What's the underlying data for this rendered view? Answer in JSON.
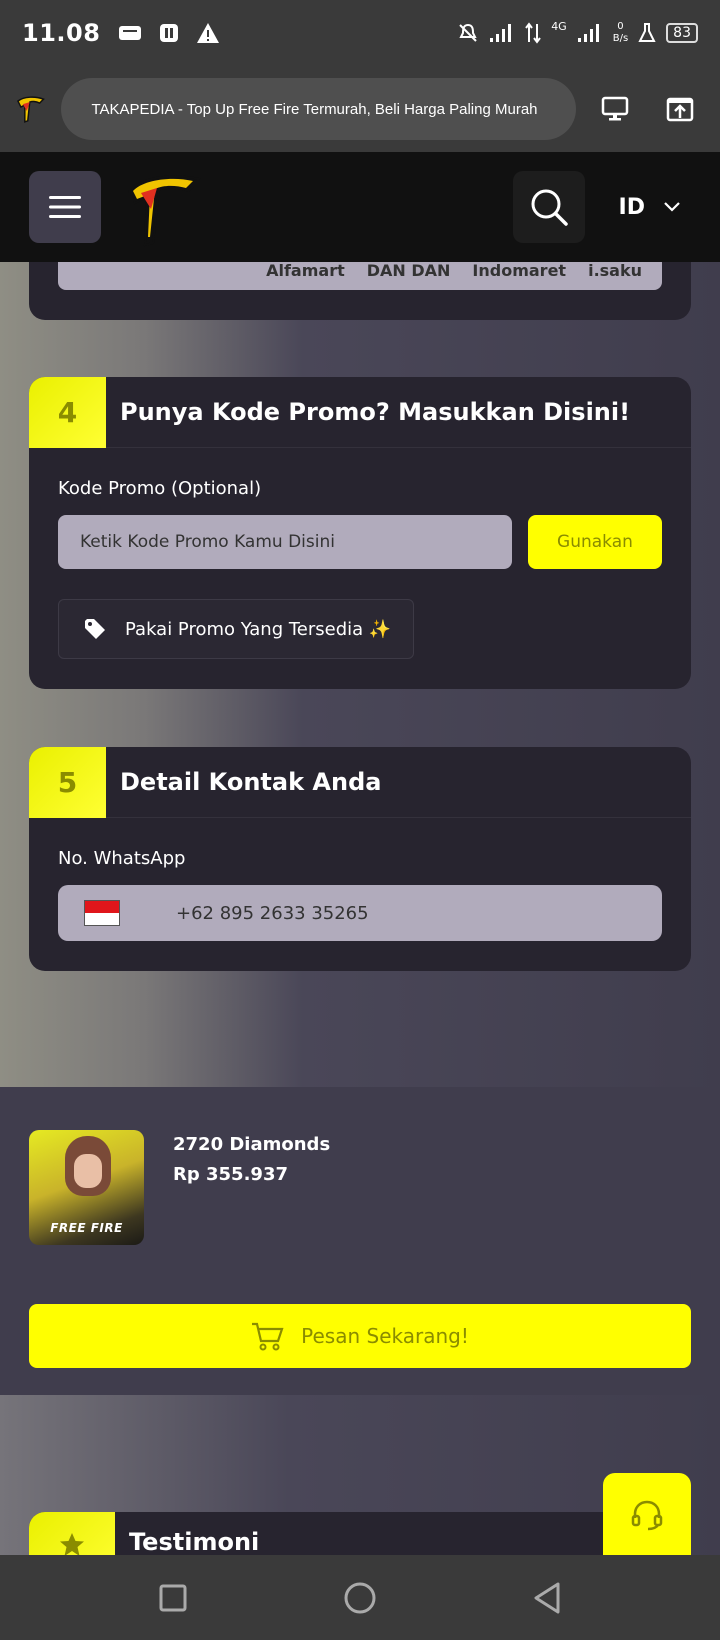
{
  "status_bar": {
    "time": "11.08",
    "network": "4G",
    "speed_value": "0",
    "speed_unit": "B/s",
    "battery": "83"
  },
  "browser": {
    "url_title": "TAKAPEDIA - Top Up Free Fire Termurah, Beli Harga Paling Murah"
  },
  "header": {
    "language": "ID"
  },
  "payment_strip": {
    "logos": [
      "Alfamart",
      "DAN DAN",
      "Indomaret",
      "i.saku"
    ]
  },
  "promo_card": {
    "step": "4",
    "title": "Punya Kode Promo? Masukkan Disini!",
    "field_label": "Kode Promo (Optional)",
    "input_placeholder": "Ketik Kode Promo Kamu Disini",
    "apply_button": "Gunakan",
    "available_button": "Pakai Promo Yang Tersedia ✨"
  },
  "contact_card": {
    "step": "5",
    "title": "Detail Kontak Anda",
    "field_label": "No. WhatsApp",
    "phone": "+62 895 2633 35265"
  },
  "summary": {
    "product_thumb_text": "FREE FIRE",
    "item": "2720 Diamonds",
    "price": "Rp 355.937",
    "order_button": "Pesan Sekarang!"
  },
  "testimoni": {
    "title": "Testimoni"
  }
}
